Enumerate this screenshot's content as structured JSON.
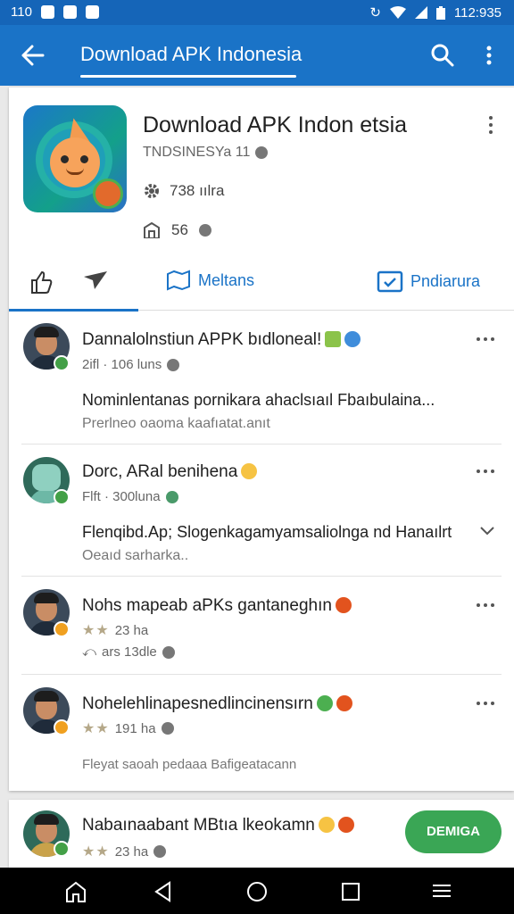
{
  "status": {
    "left_text": "110",
    "time": "112:935"
  },
  "appbar": {
    "title": "Download APK Indonesia"
  },
  "app": {
    "title": "Download APK Indon etsia",
    "developer": "TNDSINESYa 11",
    "rating_text": "738 ıılra",
    "count": "56"
  },
  "tabs": [
    {
      "label": ""
    },
    {
      "label": ""
    },
    {
      "label": "Meltans"
    },
    {
      "label": "Pndiarura"
    }
  ],
  "posts": [
    {
      "name": "Dannalolnstiun APPK bıdloneal!",
      "meta": "2ifl · 106 luns",
      "text": "Nominlentanas pornikara ahaclsıaıl Fbaıbulaina...",
      "sub": "Prerlneo oaoma kaafıatat.anıt"
    },
    {
      "name": "Dorc, ARal benihena",
      "meta": "Flft · 300luna",
      "text": "Flenqibd.Ap; Slogenkagamyamsaliolnga nd Hanaılrt",
      "sub": "Oeaıd sarharka.."
    },
    {
      "name": "Nohs mapeab aPKs gantaneghın",
      "meta": "23 ha",
      "text": "",
      "sub": "ars 13dle"
    },
    {
      "name": "Nohelehlinapesnedlincinensırn",
      "meta": "191 ha",
      "text": "",
      "sub": "Fleyat saoah pedaaa Bafigeatacann"
    }
  ],
  "bottom_post": {
    "name": "Nabaınaabant MBtıa lkeokamn",
    "meta": "23 ha",
    "download_label": "DEMIGA"
  },
  "colors": {
    "primary": "#1a73c7",
    "status": "#1565b8",
    "download": "#3aa655",
    "badge_green": "#43a047",
    "badge_orange": "#f0a020"
  }
}
